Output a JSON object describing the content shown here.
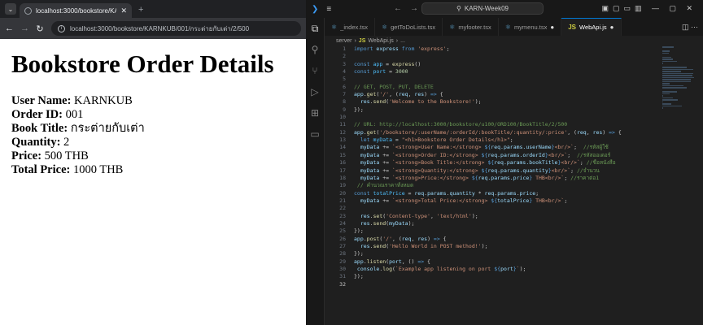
{
  "browser": {
    "tab_title": "localhost:3000/bookstore/KARI",
    "url": "localhost:3000/bookstore/KARNKUB/001/กระต่ายกับเต่า/2/500",
    "page": {
      "heading": "Bookstore Order Details",
      "fields": [
        {
          "label": "User Name:",
          "value": "KARNKUB"
        },
        {
          "label": "Order ID:",
          "value": "001"
        },
        {
          "label": "Book Title:",
          "value": "กระต่ายกับเต่า"
        },
        {
          "label": "Quantity:",
          "value": "2"
        },
        {
          "label": "Price:",
          "value": "500 THB"
        },
        {
          "label": "Total Price:",
          "value": "1000 THB"
        }
      ]
    }
  },
  "vscode": {
    "search": "KARN-Week09",
    "tabs": [
      {
        "label": "_index.tsx",
        "icon": "react-icon",
        "active": false
      },
      {
        "label": "getToDoLists.tsx",
        "icon": "react-icon",
        "active": false
      },
      {
        "label": "myfooter.tsx",
        "icon": "react-icon",
        "active": false
      },
      {
        "label": "mymenu.tsx",
        "icon": "react-icon",
        "active": false,
        "modified": true
      },
      {
        "label": "WebApi.js",
        "icon": "js-icon",
        "active": true,
        "modified": true
      }
    ],
    "breadcrumb": {
      "folder": "server",
      "file": "WebApi.js",
      "rest": "..."
    },
    "current_line": 32,
    "code_lines": [
      "import express from 'express';",
      "",
      "const app = express()",
      "const port = 3000",
      "",
      "// GET, POST, PUT, DELETE",
      "app.get('/', (req, res) => {",
      "  res.send('Welcome to the Bookstore!');",
      "});",
      "",
      "// URL: http://localhost:3000/bookstore/u100/ORD100/BookTitle/2/500",
      "app.get('/bookstore/:userName/:orderId/:bookTitle/:quantity/:price', (req, res) => {",
      "  let myData = \"<h1>Bookstore Order Details</h1>\";",
      "  myData += `<strong>User Name:</strong> ${req.params.userName}<br/>`;  //รหัสผู้ใช้",
      "  myData += `<strong>Order ID:</strong> ${req.params.orderId}<br/>`;  //รหัสออเดอร์",
      "  myData += `<strong>Book Title:</strong> ${req.params.bookTitle}<br/>`; //ชื่อหนังสือ",
      "  myData += `<strong>Quantity:</strong> ${req.params.quantity}<br/>`; //จำนวน",
      "  myData += `<strong>Price:</strong> ${req.params.price} THB<br/>`; //ราคาต่อ1",
      " // คำนวณราคาทั้งหมด",
      "const totalPrice = req.params.quantity * req.params.price;",
      "  myData += `<strong>Total Price:</strong> ${totalPrice} THB<br/>`;",
      "",
      "  res.set('Content-type', 'text/html');",
      "  res.send(myData);",
      "});",
      "app.post('/', (req, res) => {",
      "  res.send('Hello World in POST method!');",
      "});",
      "app.listen(port, () => {",
      " console.log(`Example app listening on port ${port}`);",
      "});",
      ""
    ]
  }
}
